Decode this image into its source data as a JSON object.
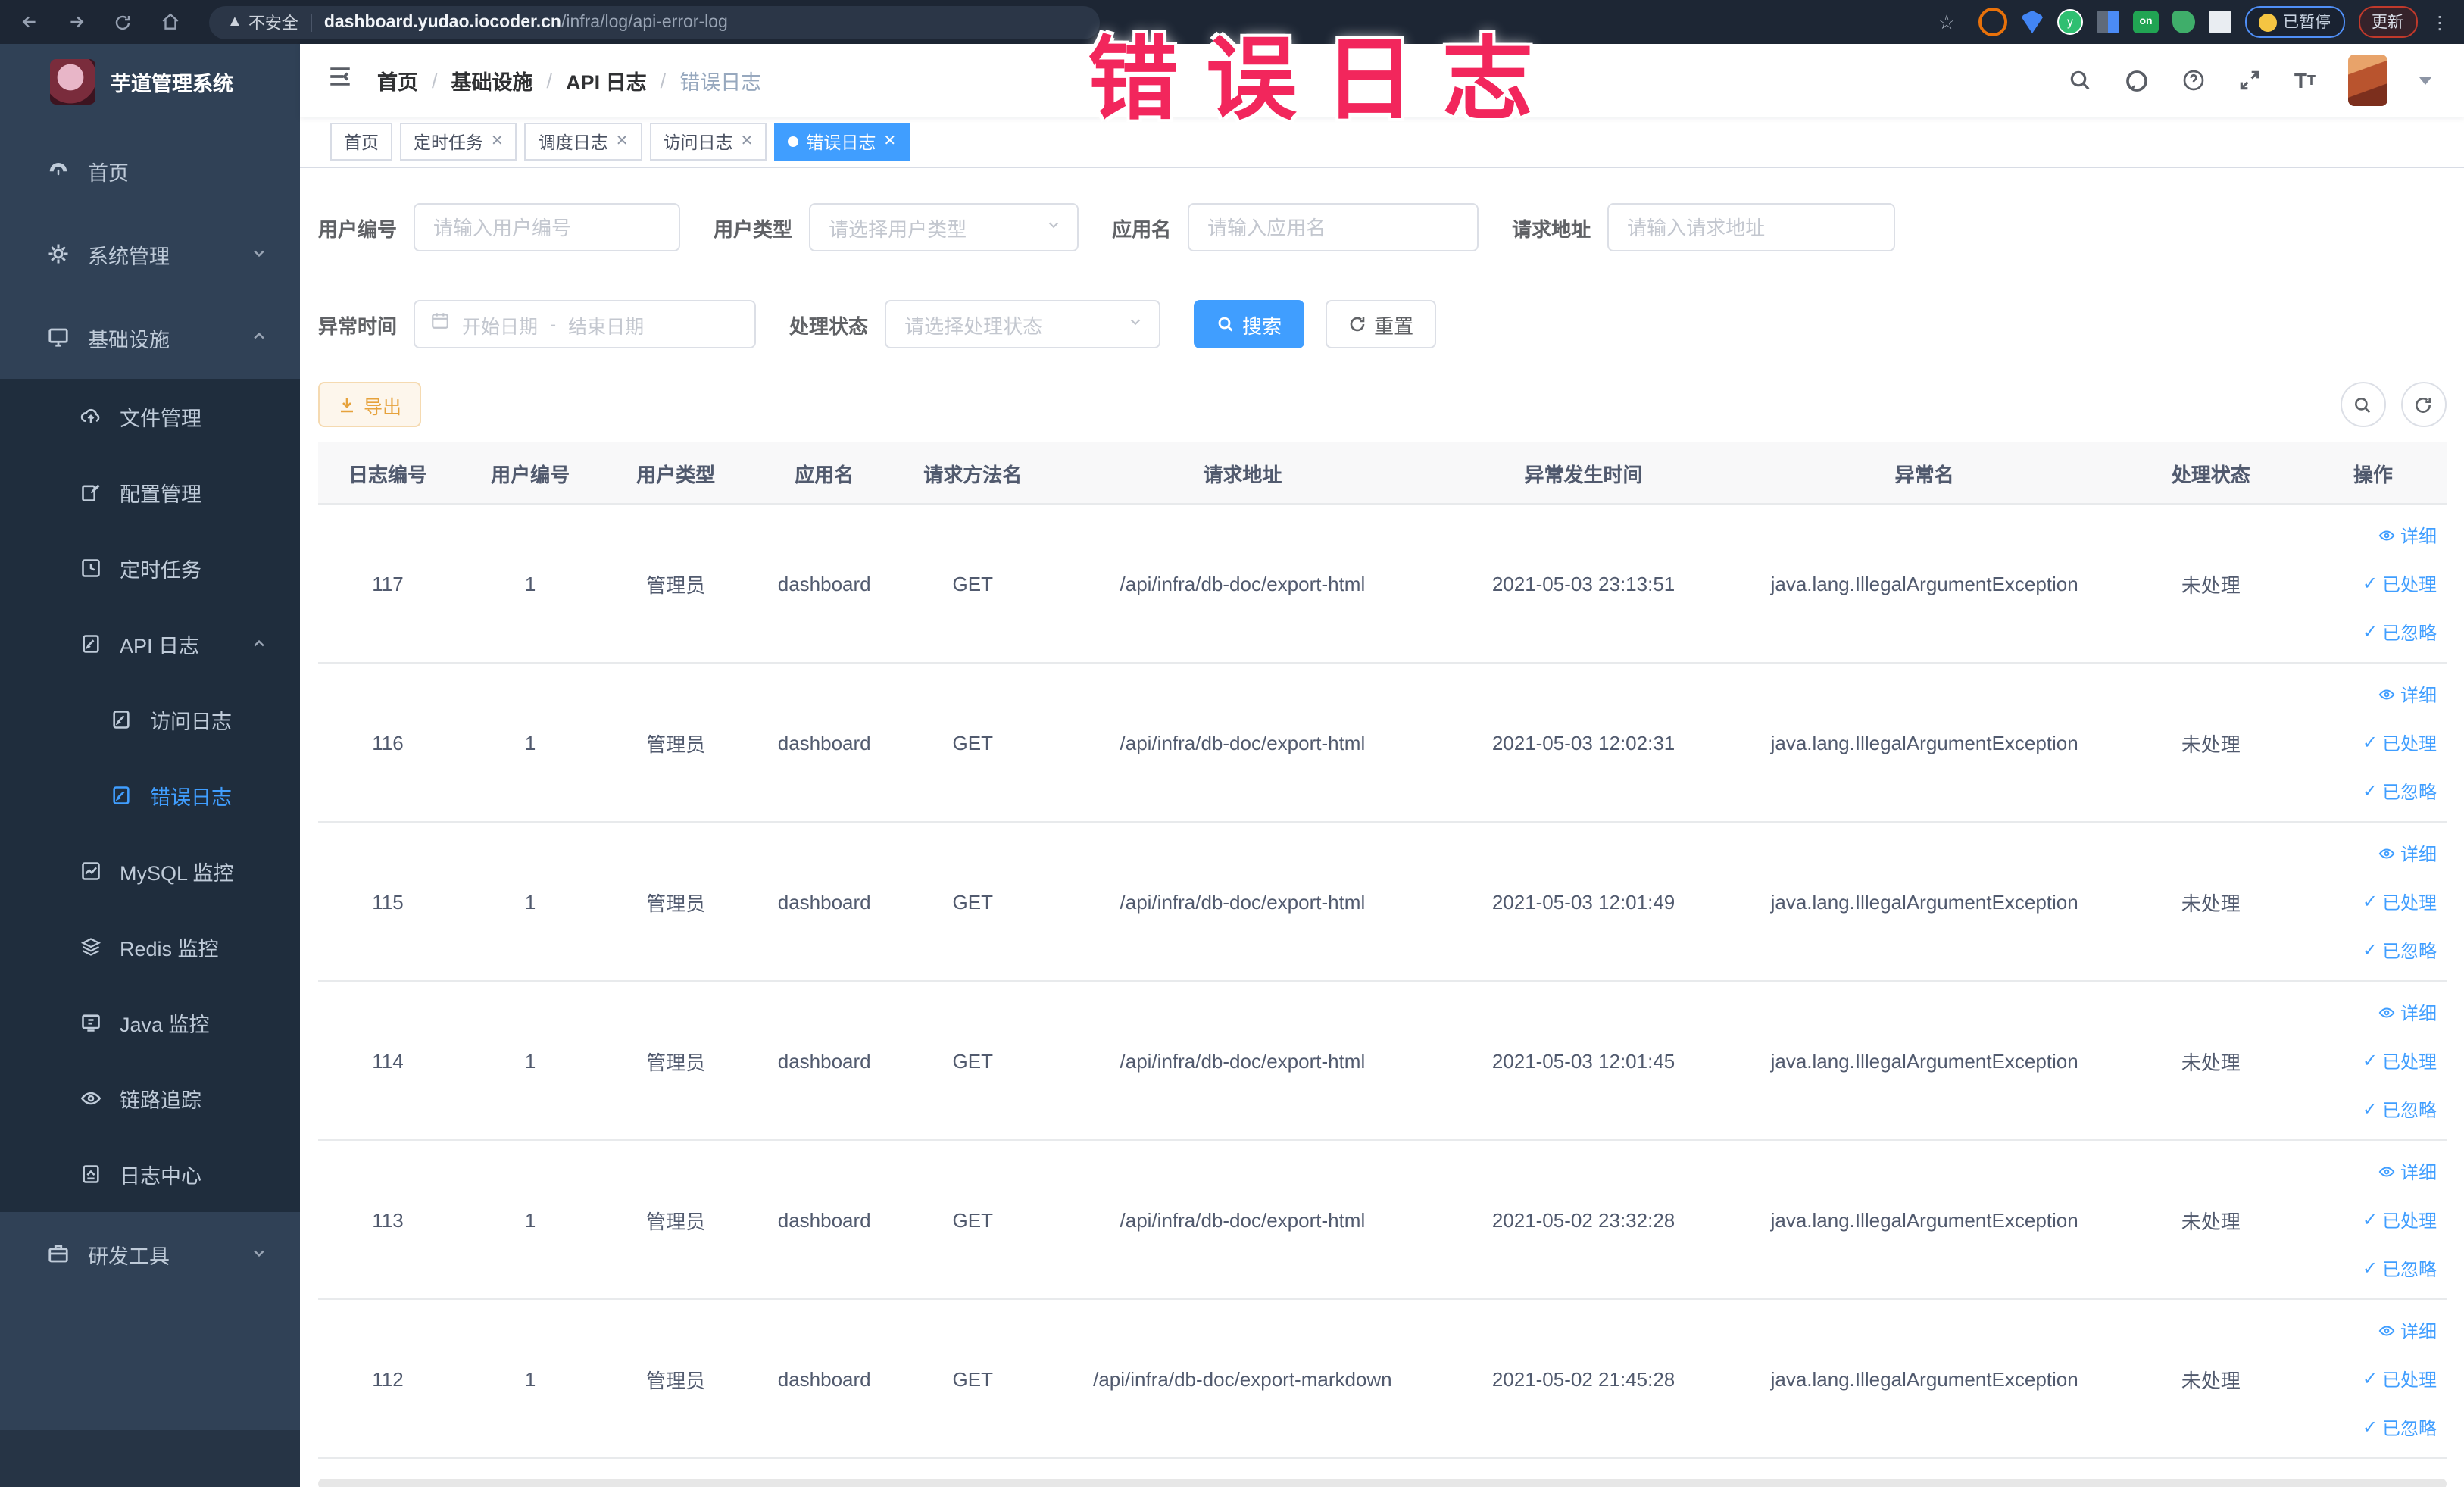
{
  "annotation": {
    "text": "错误日志",
    "color": "#f2265c"
  },
  "browser": {
    "security_label": "不安全",
    "url_host": "dashboard.yudao.iocoder.cn",
    "url_path": "/infra/log/api-error-log",
    "extension_toggle": "on",
    "paused_badge": "已暂停",
    "update_button": "更新"
  },
  "sidebar": {
    "app_title": "芋道管理系统",
    "items": {
      "home": "首页",
      "system": "系统管理",
      "infra": "基础设施",
      "dev_tools": "研发工具"
    },
    "infra_children": {
      "file": "文件管理",
      "config": "配置管理",
      "job": "定时任务",
      "api_log": "API 日志",
      "access_log": "访问日志",
      "error_log": "错误日志",
      "mysql": "MySQL 监控",
      "redis": "Redis 监控",
      "java": "Java 监控",
      "trace": "链路追踪",
      "log_center": "日志中心"
    }
  },
  "topbar": {
    "breadcrumb": [
      "首页",
      "基础设施",
      "API 日志",
      "错误日志"
    ],
    "separator": "/"
  },
  "tabs": [
    {
      "label": "首页"
    },
    {
      "label": "定时任务"
    },
    {
      "label": "调度日志"
    },
    {
      "label": "访问日志"
    },
    {
      "label": "错误日志"
    }
  ],
  "filters": {
    "user_id": {
      "label": "用户编号",
      "placeholder": "请输入用户编号"
    },
    "user_type": {
      "label": "用户类型",
      "placeholder": "请选择用户类型"
    },
    "app_name": {
      "label": "应用名",
      "placeholder": "请输入应用名"
    },
    "request_url": {
      "label": "请求地址",
      "placeholder": "请输入请求地址"
    },
    "exception_time": {
      "label": "异常时间",
      "start_placeholder": "开始日期",
      "separator": "-",
      "end_placeholder": "结束日期"
    },
    "process_status": {
      "label": "处理状态",
      "placeholder": "请选择处理状态"
    },
    "search_button": "搜索",
    "reset_button": "重置"
  },
  "toolbar": {
    "export_button": "导出"
  },
  "table": {
    "headers": [
      "日志编号",
      "用户编号",
      "用户类型",
      "应用名",
      "请求方法名",
      "请求地址",
      "异常发生时间",
      "异常名",
      "处理状态",
      "操作"
    ],
    "actions": {
      "detail": "详细",
      "processed": "已处理",
      "ignored": "已忽略"
    },
    "rows": [
      [
        "117",
        "1",
        "管理员",
        "dashboard",
        "GET",
        "/api/infra/db-doc/export-html",
        "2021-05-03 23:13:51",
        "java.lang.IllegalArgumentException",
        "未处理"
      ],
      [
        "116",
        "1",
        "管理员",
        "dashboard",
        "GET",
        "/api/infra/db-doc/export-html",
        "2021-05-03 12:02:31",
        "java.lang.IllegalArgumentException",
        "未处理"
      ],
      [
        "115",
        "1",
        "管理员",
        "dashboard",
        "GET",
        "/api/infra/db-doc/export-html",
        "2021-05-03 12:01:49",
        "java.lang.IllegalArgumentException",
        "未处理"
      ],
      [
        "114",
        "1",
        "管理员",
        "dashboard",
        "GET",
        "/api/infra/db-doc/export-html",
        "2021-05-03 12:01:45",
        "java.lang.IllegalArgumentException",
        "未处理"
      ],
      [
        "113",
        "1",
        "管理员",
        "dashboard",
        "GET",
        "/api/infra/db-doc/export-html",
        "2021-05-02 23:32:28",
        "java.lang.IllegalArgumentException",
        "未处理"
      ],
      [
        "112",
        "1",
        "管理员",
        "dashboard",
        "GET",
        "/api/infra/db-doc/export-markdown",
        "2021-05-02 21:45:28",
        "java.lang.IllegalArgumentException",
        "未处理"
      ]
    ]
  },
  "colors": {
    "accent": "#409eff",
    "warning": "#e6a23c",
    "annotation": "#f2265c",
    "chrome_bg": "#1d2634",
    "sidebar_bg": "#304156",
    "submenu_bg": "#1f2d3d",
    "active_tab_bg": "#409eff"
  }
}
